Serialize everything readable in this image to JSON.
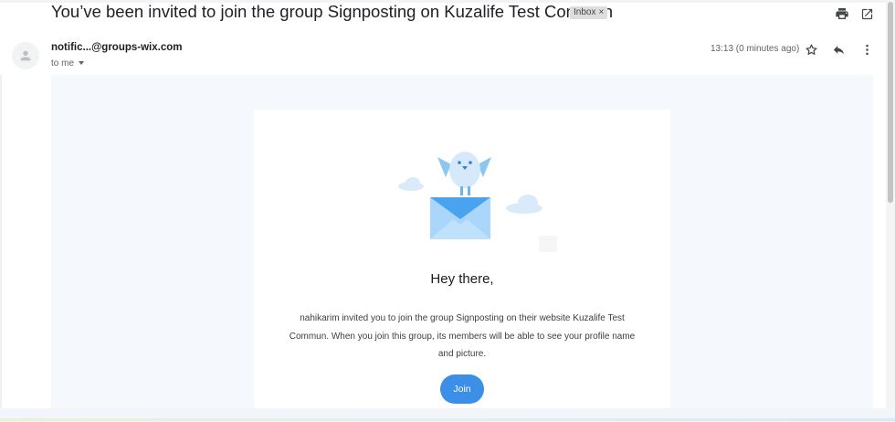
{
  "email": {
    "subject": "You’ve been invited to join the group Signposting on Kuzalife Test Commun",
    "label_badge": "Inbox",
    "label_badge_close": "×",
    "sender": "notific...@groups-wix.com",
    "recipient": "to me",
    "timestamp": "13:13 (0 minutes ago)"
  },
  "icons": {
    "print": "print-icon",
    "open_new_window": "open-in-new-window-icon",
    "star": "star-icon",
    "reply": "reply-icon",
    "more": "more-vertical-icon",
    "avatar": "person-icon"
  },
  "body": {
    "greeting": "Hey there,",
    "message_line1": "nahikarim invited you to join the group Signposting on their website Kuzalife Test",
    "message_line2": "Commun. When you join this group, its members will be able to see your profile name",
    "message_line3": "and picture.",
    "join_label": "Join"
  },
  "colors": {
    "accent": "#3b8fe6",
    "email_background": "#f5f8fd",
    "badge_background": "#dddddd"
  }
}
